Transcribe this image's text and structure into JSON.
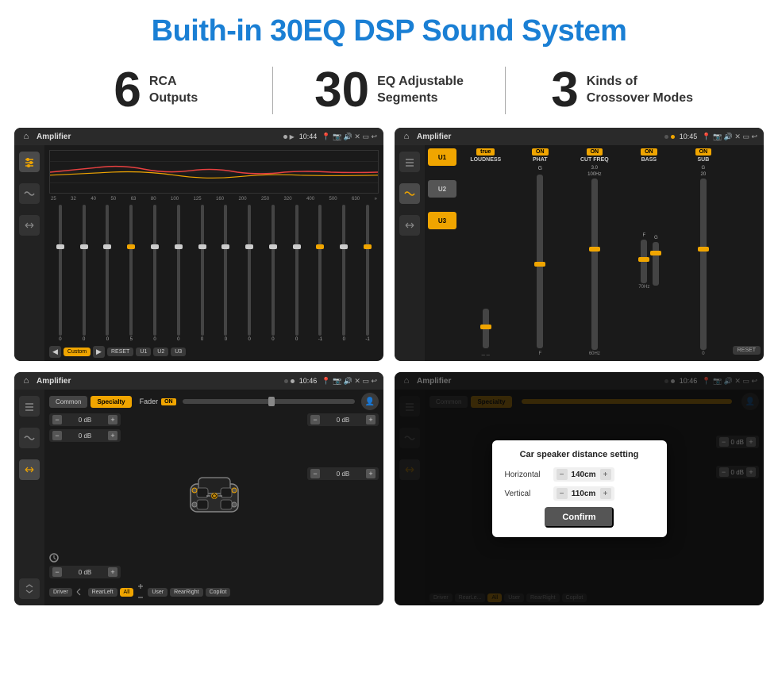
{
  "page": {
    "title": "Buith-in 30EQ DSP Sound System",
    "stats": [
      {
        "number": "6",
        "label": "RCA\nOutputs"
      },
      {
        "number": "30",
        "label": "EQ Adjustable\nSegments"
      },
      {
        "number": "3",
        "label": "Kinds of\nCrossover Modes"
      }
    ]
  },
  "screens": [
    {
      "id": "eq",
      "topbar": {
        "title": "Amplifier",
        "time": "10:44",
        "icons": "📍 📷 🔊 ✕ ▭ ↩"
      },
      "eq_freqs": [
        "25",
        "32",
        "40",
        "50",
        "63",
        "80",
        "100",
        "125",
        "160",
        "200",
        "250",
        "320",
        "400",
        "500",
        "630"
      ],
      "eq_values": [
        "0",
        "0",
        "0",
        "5",
        "0",
        "0",
        "0",
        "0",
        "0",
        "0",
        "0",
        "-1",
        "0",
        "-1"
      ],
      "preset": "Custom",
      "presets": [
        "RESET",
        "U1",
        "U2",
        "U3"
      ]
    },
    {
      "id": "amp-controls",
      "topbar": {
        "title": "Amplifier",
        "time": "10:45"
      },
      "channels": [
        "U1",
        "U2",
        "U3"
      ],
      "controls": [
        {
          "label": "LOUDNESS",
          "on": true
        },
        {
          "label": "PHAT",
          "on": true
        },
        {
          "label": "CUT FREQ",
          "on": true
        },
        {
          "label": "BASS",
          "on": true
        },
        {
          "label": "SUB",
          "on": true
        }
      ],
      "reset": "RESET"
    },
    {
      "id": "speaker-zones",
      "topbar": {
        "title": "Amplifier",
        "time": "10:46"
      },
      "tabs": [
        "Common",
        "Specialty"
      ],
      "fader_label": "Fader",
      "fader_on": "ON",
      "zones": [
        {
          "label": "0 dB"
        },
        {
          "label": "0 dB"
        },
        {
          "label": "0 dB"
        },
        {
          "label": "0 dB"
        }
      ],
      "buttons": [
        "Driver",
        "RearLeft",
        "All",
        "User",
        "RearRight",
        "Copilot"
      ]
    },
    {
      "id": "speaker-distance",
      "topbar": {
        "title": "Amplifier",
        "time": "10:46"
      },
      "tabs": [
        "Common",
        "Specialty"
      ],
      "dialog": {
        "title": "Car speaker distance setting",
        "horizontal_label": "Horizontal",
        "horizontal_value": "140cm",
        "vertical_label": "Vertical",
        "vertical_value": "110cm",
        "confirm_label": "Confirm"
      },
      "zones": [
        {
          "label": "0 dB"
        },
        {
          "label": "0 dB"
        }
      ],
      "buttons": [
        "Driver",
        "RearLeft",
        "All",
        "User",
        "RearRight",
        "Copilot"
      ]
    }
  ],
  "icons": {
    "home": "⌂",
    "play": "▶",
    "pause": "⏸",
    "back": "↩",
    "close": "✕",
    "minimize": "▭",
    "location": "📍",
    "camera": "📷",
    "volume": "🔊",
    "settings": "⚙",
    "tune": "≡",
    "wave": "〜",
    "arrows": "↔",
    "person": "👤",
    "chevron_up": "▲",
    "chevron_down": "▼",
    "chevron_left": "◀",
    "chevron_right": "▶",
    "minus": "−",
    "plus": "+"
  }
}
